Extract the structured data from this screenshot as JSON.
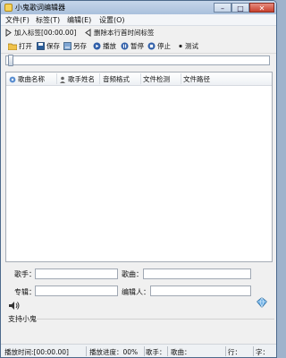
{
  "window": {
    "title": "小鬼歌词编辑器",
    "buttons": {
      "minimize": "–",
      "maximize": "□",
      "close": "✕"
    }
  },
  "menu": [
    "文件(F)",
    "标签(T)",
    "编辑(E)",
    "设置(O)"
  ],
  "toolbar1": {
    "add_tag": "加入标签[00:00.00]",
    "delete_tag": "删除本行首时间标签"
  },
  "toolbar2": {
    "open": "打开",
    "save": "保存",
    "save_as": "另存",
    "play": "播放",
    "pause": "暂停",
    "stop": "停止",
    "test": "测试"
  },
  "progress": {
    "value": 0
  },
  "list_columns": [
    "歌曲名称",
    "歌手姓名",
    "音频格式",
    "文件检测",
    "文件路径"
  ],
  "form": {
    "singer_label": "歌手：",
    "singer_value": "",
    "song_label": "歌曲：",
    "song_value": "",
    "album_label": "专辑：",
    "album_value": "",
    "editor_label": "编辑人：",
    "editor_value": ""
  },
  "support": "支持小鬼",
  "status": {
    "play_time": "播放时间:[00:00.00]",
    "play_progress": "播放进度：00%",
    "singer": "歌手：",
    "song": "歌曲：",
    "row": "行：",
    "char": "字："
  },
  "colors": {
    "title_bar": "#b8cce4",
    "close_button": "#c8402d",
    "play_icon": "#2f5ea8",
    "save_icon": "#2d5f9a"
  },
  "icons": {
    "app": "lyric-editor-icon",
    "add_tag": "add-tag-icon",
    "delete_tag": "delete-tag-icon",
    "open": "folder-icon",
    "save": "save-icon",
    "save_as": "save-as-icon",
    "play": "play-icon",
    "pause": "pause-icon",
    "stop": "stop-icon",
    "test": "test-dot-icon",
    "volume": "speaker-icon",
    "gem": "gem-icon"
  }
}
